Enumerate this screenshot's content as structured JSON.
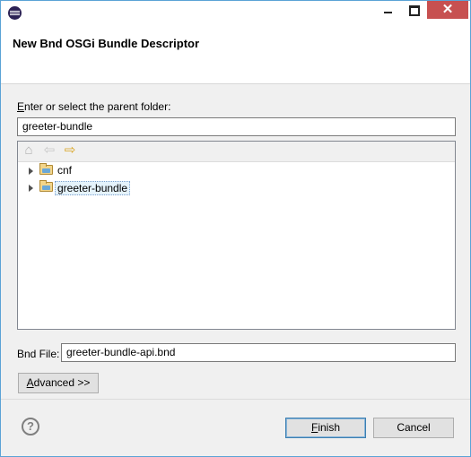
{
  "window": {
    "title_icon": "eclipse-icon",
    "controls": {
      "minimize": "minimize-icon",
      "maximize": "maximize-icon",
      "close": "✕"
    }
  },
  "header": {
    "title": "New Bnd OSGi Bundle Descriptor"
  },
  "folder_picker": {
    "label_underlined": "E",
    "label_rest": "nter or select the parent folder:",
    "value": "greeter-bundle",
    "toolbar": [
      "home-icon",
      "back-arrow-icon",
      "forward-arrow-icon"
    ],
    "tree": [
      {
        "label": "cnf",
        "selected": false
      },
      {
        "label": "greeter-bundle",
        "selected": true
      }
    ]
  },
  "bnd_file": {
    "label": "Bnd File:",
    "value": "greeter-bundle-api.bnd"
  },
  "buttons": {
    "advanced_underlined": "A",
    "advanced_rest": "dvanced >>",
    "finish_underlined": "F",
    "finish_rest": "inish",
    "cancel": "Cancel",
    "help": "?"
  }
}
